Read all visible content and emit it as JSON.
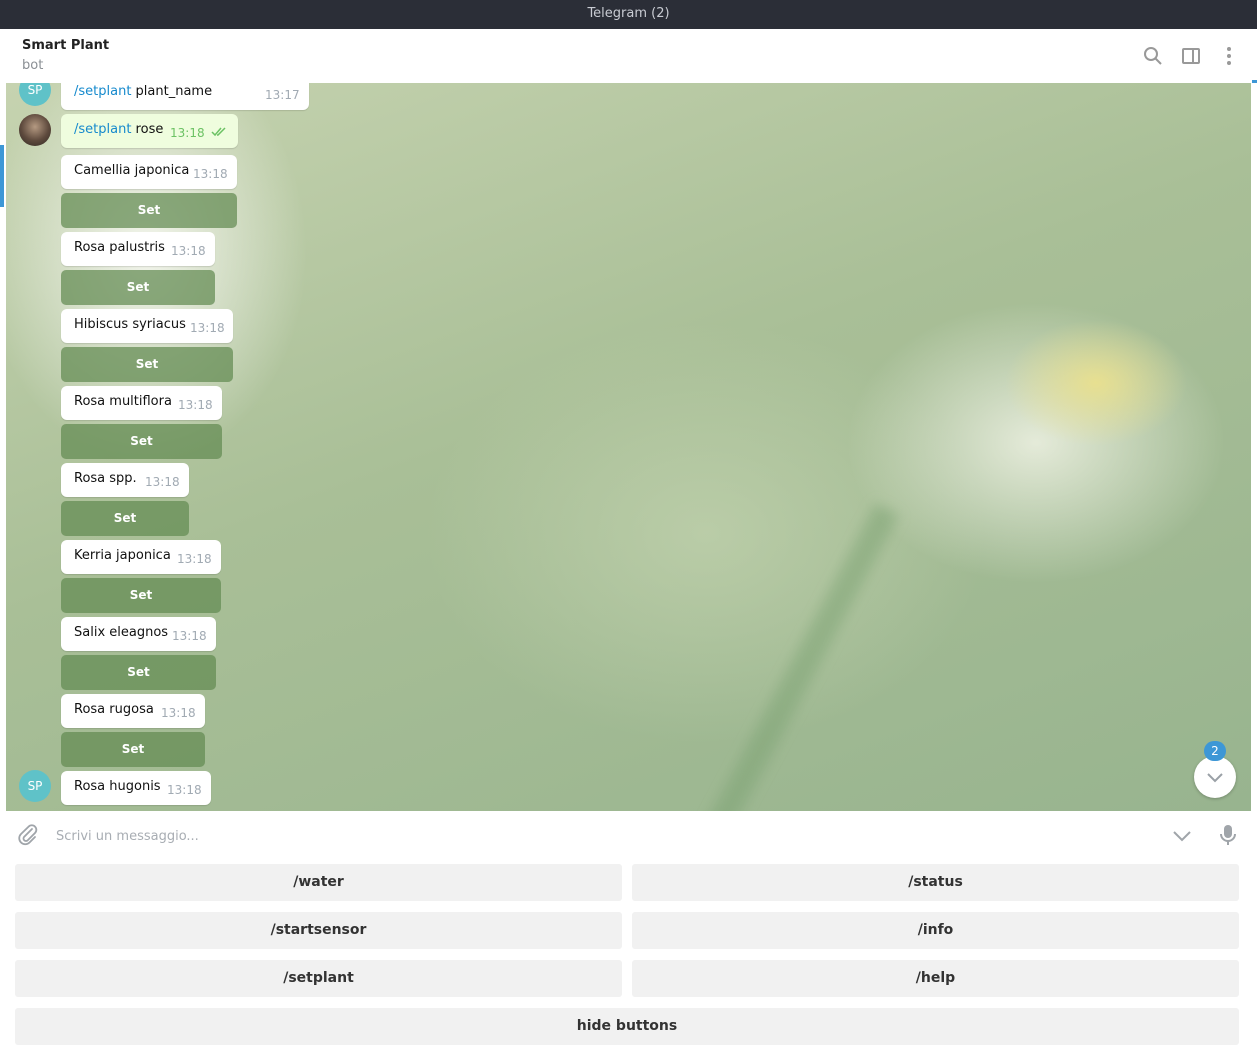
{
  "window": {
    "title": "Telegram (2)"
  },
  "header": {
    "name": "Smart Plant",
    "subtitle": "bot"
  },
  "messages": [
    {
      "cmd": "/setplant",
      "text": " plant_name",
      "time": "13:17"
    },
    {
      "cmd": "/setplant",
      "text": " rose",
      "time": "13:18"
    },
    {
      "text": "Camellia japonica",
      "time": "13:18",
      "button": "Set"
    },
    {
      "text": "Rosa palustris",
      "time": "13:18",
      "button": "Set"
    },
    {
      "text": "Hibiscus syriacus",
      "time": "13:18",
      "button": "Set"
    },
    {
      "text": "Rosa multiflora",
      "time": "13:18",
      "button": "Set"
    },
    {
      "text": "Rosa spp.",
      "time": "13:18",
      "button": "Set"
    },
    {
      "text": "Kerria japonica",
      "time": "13:18",
      "button": "Set"
    },
    {
      "text": "Salix eleagnos",
      "time": "13:18",
      "button": "Set"
    },
    {
      "text": "Rosa rugosa",
      "time": "13:18",
      "button": "Set"
    },
    {
      "text": "Rosa hugonis",
      "time": "13:18"
    }
  ],
  "avatars": {
    "bot_initials": "SP"
  },
  "unread_badge": "2",
  "composer": {
    "placeholder": "Scrivi un messaggio..."
  },
  "keyboard": {
    "buttons": [
      "/water",
      "/status",
      "/startsensor",
      "/info",
      "/setplant",
      "/help"
    ],
    "hide": "hide buttons"
  },
  "colors": {
    "accent": "#3d97d6",
    "titlebar": "#2b2e37",
    "inline_button": "#628a52",
    "outgoing_bubble": "#effdde",
    "command": "#168acd"
  },
  "icons": [
    "search-icon",
    "sidebar-toggle-icon",
    "more-vert-icon",
    "attach-icon",
    "chevron-down-icon",
    "microphone-icon",
    "double-check-icon"
  ]
}
